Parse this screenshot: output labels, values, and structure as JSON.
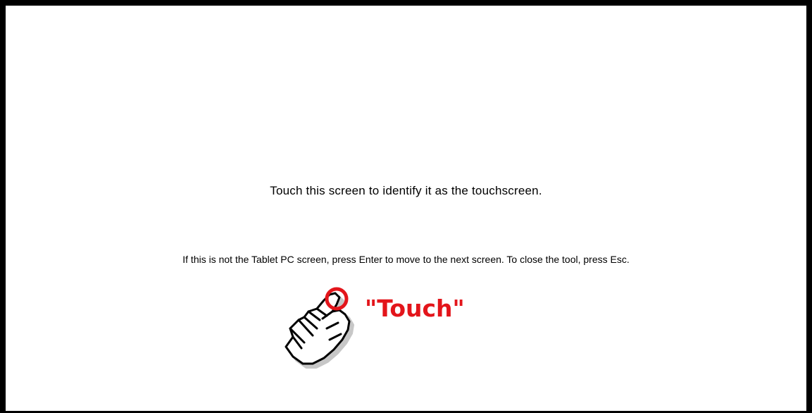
{
  "screen": {
    "prompt": "Touch this screen to identify it as the touchscreen.",
    "instruction": "If this is not the Tablet PC screen, press Enter to move to the next screen. To close the tool, press Esc."
  },
  "hint": {
    "label": "\"Touch\"",
    "icon": "pointing-hand-icon",
    "accent_color": "#e3151b"
  }
}
